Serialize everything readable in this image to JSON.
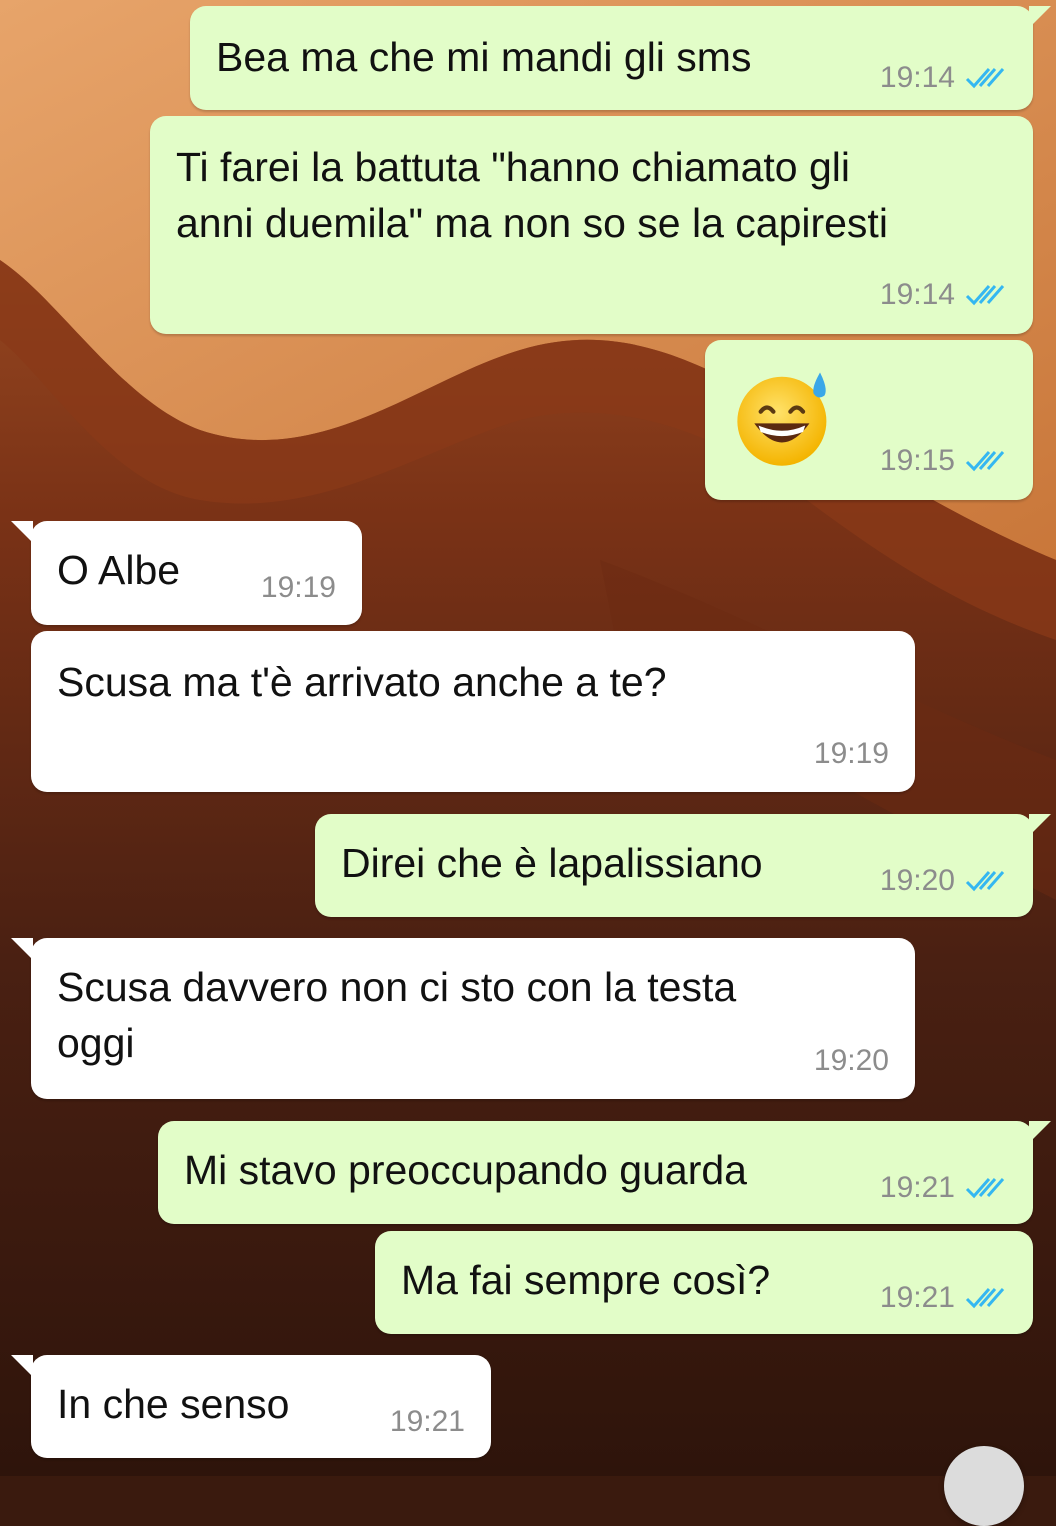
{
  "chat": {
    "messages": [
      {
        "dir": "out",
        "text": "Bea ma che mi mandi gli sms",
        "time": "19:14",
        "status": "read"
      },
      {
        "dir": "out",
        "text_lines": [
          "Ti farei la battuta \"hanno chiamato gli",
          "anni duemila\" ma non so se la capiresti"
        ],
        "time": "19:14",
        "status": "read"
      },
      {
        "dir": "out",
        "emoji": "grinning-face-with-sweat",
        "time": "19:15",
        "status": "read"
      },
      {
        "dir": "in",
        "text": "O Albe",
        "time": "19:19"
      },
      {
        "dir": "in",
        "text": "Scusa ma t'è arrivato anche a te?",
        "time": "19:19"
      },
      {
        "dir": "out",
        "text": "Direi che è lapalissiano",
        "time": "19:20",
        "status": "read"
      },
      {
        "dir": "in",
        "text_lines": [
          "Scusa davvero non ci sto con la testa",
          "oggi"
        ],
        "time": "19:20"
      },
      {
        "dir": "out",
        "text": "Mi stavo preoccupando guarda",
        "time": "19:21",
        "status": "read"
      },
      {
        "dir": "out",
        "text": "Ma fai sempre così?",
        "time": "19:21",
        "status": "read"
      },
      {
        "dir": "in",
        "text": "In che senso",
        "time": "19:21"
      }
    ]
  },
  "colors": {
    "outgoing_bubble": "#e2fdc8",
    "incoming_bubble": "#ffffff",
    "read_ticks": "#34b7f1",
    "timestamp": "#8c8c8c"
  },
  "icons": {
    "read_receipt": "double-check-icon",
    "scroll_button": "scroll-down-button"
  }
}
